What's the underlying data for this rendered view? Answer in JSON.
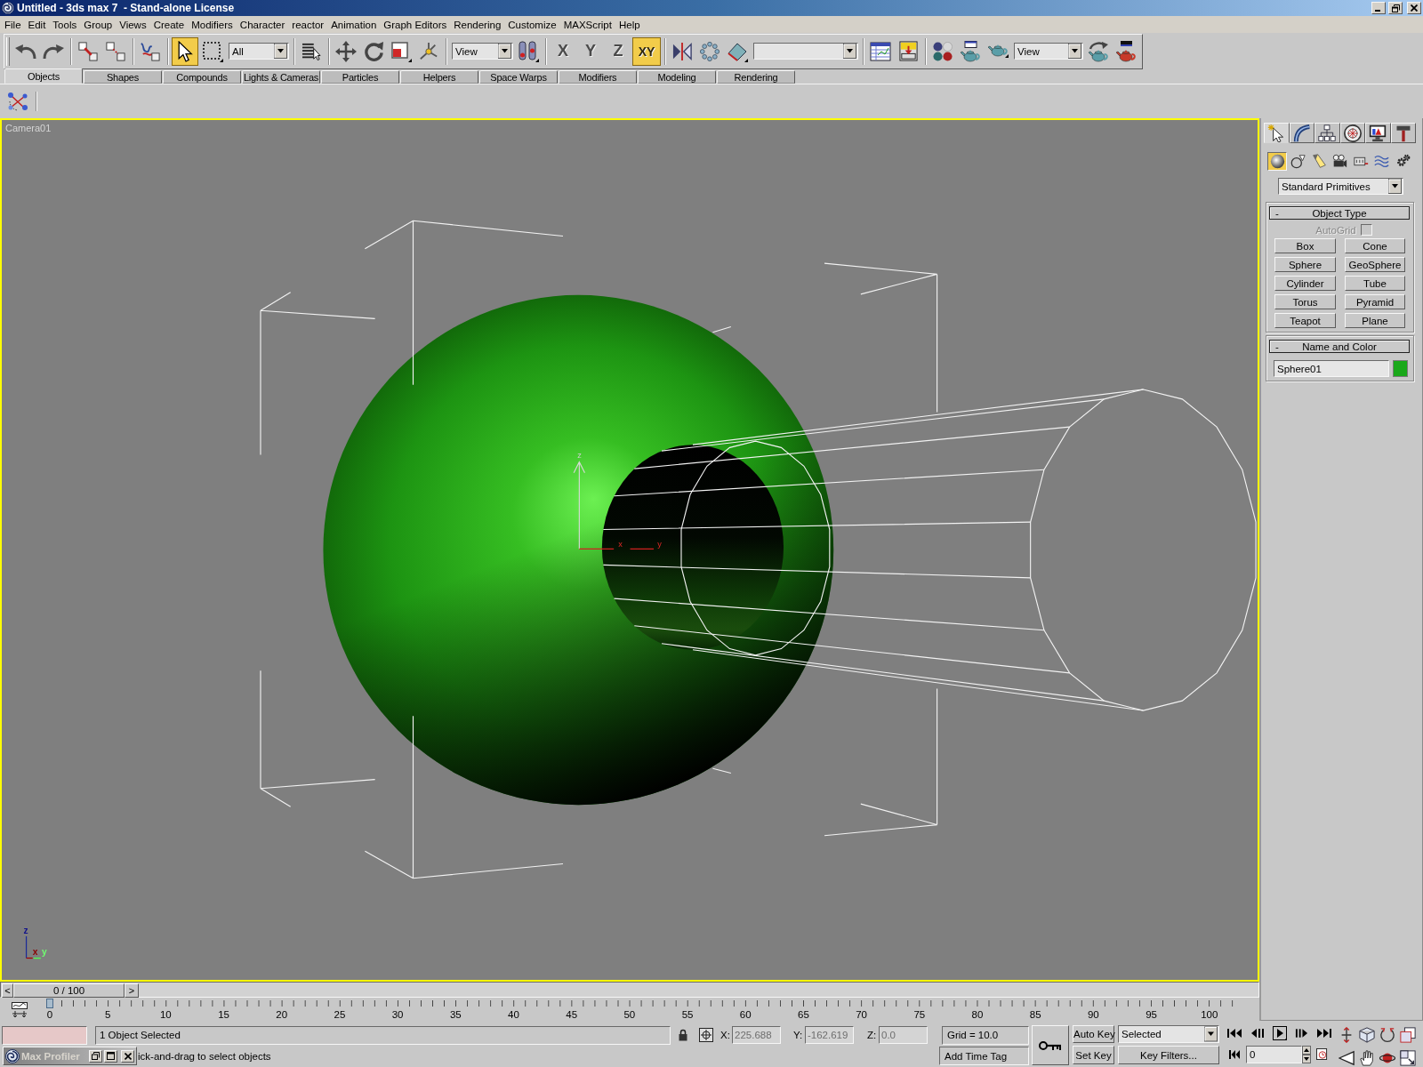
{
  "window": {
    "title": "Untitled - 3ds max 7  - Stand-alone License"
  },
  "menu": [
    "File",
    "Edit",
    "Tools",
    "Group",
    "Views",
    "Create",
    "Modifiers",
    "Character",
    "reactor",
    "Animation",
    "Graph Editors",
    "Rendering",
    "Customize",
    "MAXScript",
    "Help"
  ],
  "toolbar": [
    [
      {
        "kind": "icon",
        "selected": false
      },
      {
        "kind": "icon",
        "selected": false
      }
    ],
    [
      {
        "kind": "icon",
        "selected": false
      },
      {
        "kind": "icon",
        "selected": false
      }
    ],
    [
      {
        "kind": "icon",
        "selected": false
      }
    ],
    [
      {
        "kind": "icon",
        "selected": true
      },
      {
        "kind": "icon",
        "selected": false
      },
      {
        "kind": "dropdown",
        "value": "All"
      }
    ],
    [
      {
        "kind": "icon",
        "selected": false
      }
    ],
    [
      {
        "kind": "icon",
        "selected": false
      },
      {
        "kind": "icon",
        "selected": false
      },
      {
        "kind": "icon",
        "selected": false
      },
      {
        "kind": "icon",
        "selected": false
      }
    ],
    [
      {
        "kind": "dropdown",
        "value": "View"
      },
      {
        "kind": "icon",
        "selected": false
      }
    ],
    [
      {
        "kind": "axis",
        "label": "X",
        "selected": false
      },
      {
        "kind": "axis",
        "label": "Y",
        "selected": false
      },
      {
        "kind": "axis",
        "label": "Z",
        "selected": false
      },
      {
        "kind": "axis",
        "label": "XY",
        "selected": true
      }
    ],
    [
      {
        "kind": "icon",
        "selected": false
      },
      {
        "kind": "icon",
        "selected": false
      },
      {
        "kind": "icon",
        "selected": false
      },
      {
        "kind": "dropdown"
      }
    ],
    [
      {
        "kind": "icon",
        "selected": false
      },
      {
        "kind": "icon",
        "selected": false
      }
    ],
    [
      {
        "kind": "icon",
        "selected": false
      },
      {
        "kind": "icon",
        "selected": false
      },
      {
        "kind": "icon",
        "selected": false
      },
      {
        "kind": "dropdown",
        "value": "View"
      },
      {
        "kind": "icon",
        "selected": false
      },
      {
        "kind": "icon",
        "selected": false
      }
    ]
  ],
  "tabs": [
    {
      "label": "Objects",
      "selected": true
    },
    {
      "label": "Shapes",
      "selected": false
    },
    {
      "label": "Compounds",
      "selected": false
    },
    {
      "label": "Lights & Cameras",
      "selected": false
    },
    {
      "label": "Particles",
      "selected": false
    },
    {
      "label": "Helpers",
      "selected": false
    },
    {
      "label": "Space Warps",
      "selected": false
    },
    {
      "label": "Modifiers",
      "selected": false
    },
    {
      "label": "Modeling",
      "selected": false
    },
    {
      "label": "Rendering",
      "selected": false
    }
  ],
  "viewport": {
    "label": "Camera01",
    "active": true,
    "gizmo_labels": [
      "z",
      "x",
      "y"
    ],
    "tripod_labels": [
      "z",
      "x",
      "y"
    ]
  },
  "command_panel": {
    "tabs": [
      {
        "selected": true
      },
      {
        "selected": false
      },
      {
        "selected": false
      },
      {
        "selected": false
      },
      {
        "selected": false
      },
      {
        "selected": false
      }
    ],
    "categories": [
      {
        "selected": true
      },
      {
        "selected": false
      },
      {
        "selected": false
      },
      {
        "selected": false
      },
      {
        "selected": false
      },
      {
        "selected": false
      },
      {
        "selected": false
      }
    ],
    "type": "Standard Primitives",
    "object_type": {
      "sign": "-",
      "title": "Object Type",
      "autogrid": {
        "label": "AutoGrid",
        "checked": false,
        "disabled": true
      },
      "buttons": [
        {
          "label": "Box",
          "selected": false
        },
        {
          "label": "Cone",
          "selected": false
        },
        {
          "label": "Sphere",
          "selected": false
        },
        {
          "label": "GeoSphere",
          "selected": false
        },
        {
          "label": "Cylinder",
          "selected": false
        },
        {
          "label": "Tube",
          "selected": false
        },
        {
          "label": "Torus",
          "selected": false
        },
        {
          "label": "Pyramid",
          "selected": false
        },
        {
          "label": "Teapot",
          "selected": false
        },
        {
          "label": "Plane",
          "selected": false
        }
      ]
    },
    "name_and_color": {
      "sign": "-",
      "title": "Name and Color",
      "name": "Sphere01",
      "color": "#1aa81a"
    }
  },
  "timeline": {
    "slider": {
      "prev": "<",
      "label": "0 / 100",
      "next": ">",
      "level": 0
    },
    "frame_labels": [
      "0",
      "5",
      "10",
      "15",
      "20",
      "25",
      "30",
      "35",
      "40",
      "45",
      "50",
      "55",
      "60",
      "65",
      "70",
      "75",
      "80",
      "85",
      "90",
      "95",
      "100"
    ]
  },
  "status": {
    "selection": "1 Object Selected",
    "coords": [
      {
        "label": "X:",
        "value": "225.688",
        "disabled": true
      },
      {
        "label": "Y:",
        "value": "-162.619",
        "disabled": true
      },
      {
        "label": "Z:",
        "value": "0.0",
        "disabled": true
      }
    ],
    "grid": "Grid = 10.0",
    "minimized_window": {
      "title": "Max Profiler",
      "active": false
    },
    "prompt": "ick-and-drag to select objects",
    "time_tag": "Add Time Tag",
    "auto_key": {
      "label": "Auto Key",
      "on": false
    },
    "set_key": "Set Key",
    "key_mode": "Selected",
    "key_filters": "Key Filters...",
    "frame": "0"
  }
}
